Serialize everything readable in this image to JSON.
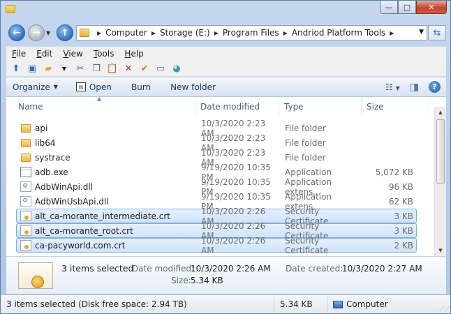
{
  "window": {
    "minimize_glyph": "—",
    "maximize_glyph": "□",
    "close_glyph": "✕"
  },
  "nav": {
    "back_glyph": "←",
    "forward_glyph": "→",
    "up_glyph": "↑",
    "recent_glyph": "▼",
    "breadcrumbs": [
      "Computer",
      "Storage (E:)",
      "Program Files",
      "Andriod Platform Tools"
    ],
    "refresh_glyph": "⇆"
  },
  "menu": [
    "File",
    "Edit",
    "View",
    "Tools",
    "Help"
  ],
  "commands": {
    "organize": "Organize",
    "open": "Open",
    "burn": "Burn",
    "new_folder": "New folder"
  },
  "columns": {
    "name": "Name",
    "date": "Date modified",
    "type": "Type",
    "size": "Size"
  },
  "files": [
    {
      "name": "api",
      "date": "10/3/2020 2:23 AM",
      "type": "File folder",
      "size": "",
      "icon": "folder-icon",
      "selected": false
    },
    {
      "name": "lib64",
      "date": "10/3/2020 2:23 AM",
      "type": "File folder",
      "size": "",
      "icon": "folder-icon",
      "selected": false
    },
    {
      "name": "systrace",
      "date": "10/3/2020 2:23 AM",
      "type": "File folder",
      "size": "",
      "icon": "folder-icon",
      "selected": false
    },
    {
      "name": "adb.exe",
      "date": "9/19/2020 10:35 PM",
      "type": "Application",
      "size": "5,072 KB",
      "icon": "exe-icon",
      "selected": false
    },
    {
      "name": "AdbWinApi.dll",
      "date": "9/19/2020 10:35 PM",
      "type": "Application extens...",
      "size": "96 KB",
      "icon": "dll-icon",
      "selected": false
    },
    {
      "name": "AdbWinUsbApi.dll",
      "date": "9/19/2020 10:35 PM",
      "type": "Application extens...",
      "size": "62 KB",
      "icon": "dll-icon",
      "selected": false
    },
    {
      "name": "alt_ca-morante_intermediate.crt",
      "date": "10/3/2020 2:26 AM",
      "type": "Security Certificate",
      "size": "3 KB",
      "icon": "certificate-icon",
      "selected": true
    },
    {
      "name": "alt_ca-morante_root.crt",
      "date": "10/3/2020 2:26 AM",
      "type": "Security Certificate",
      "size": "3 KB",
      "icon": "certificate-icon",
      "selected": true
    },
    {
      "name": "ca-pacyworld.com.crt",
      "date": "10/3/2020 2:26 AM",
      "type": "Security Certificate",
      "size": "2 KB",
      "icon": "certificate-icon",
      "selected": true
    }
  ],
  "details": {
    "count": "3 items selected",
    "date_modified_label": "Date modified:",
    "date_modified": "10/3/2020 2:26 AM",
    "date_created_label": "Date created:",
    "date_created": "10/3/2020 2:27 AM",
    "size_label": "Size:",
    "size": "5.34 KB"
  },
  "status": {
    "left": "3 items selected (Disk free space: 2.94 TB)",
    "size": "5.34 KB",
    "location": "Computer"
  }
}
